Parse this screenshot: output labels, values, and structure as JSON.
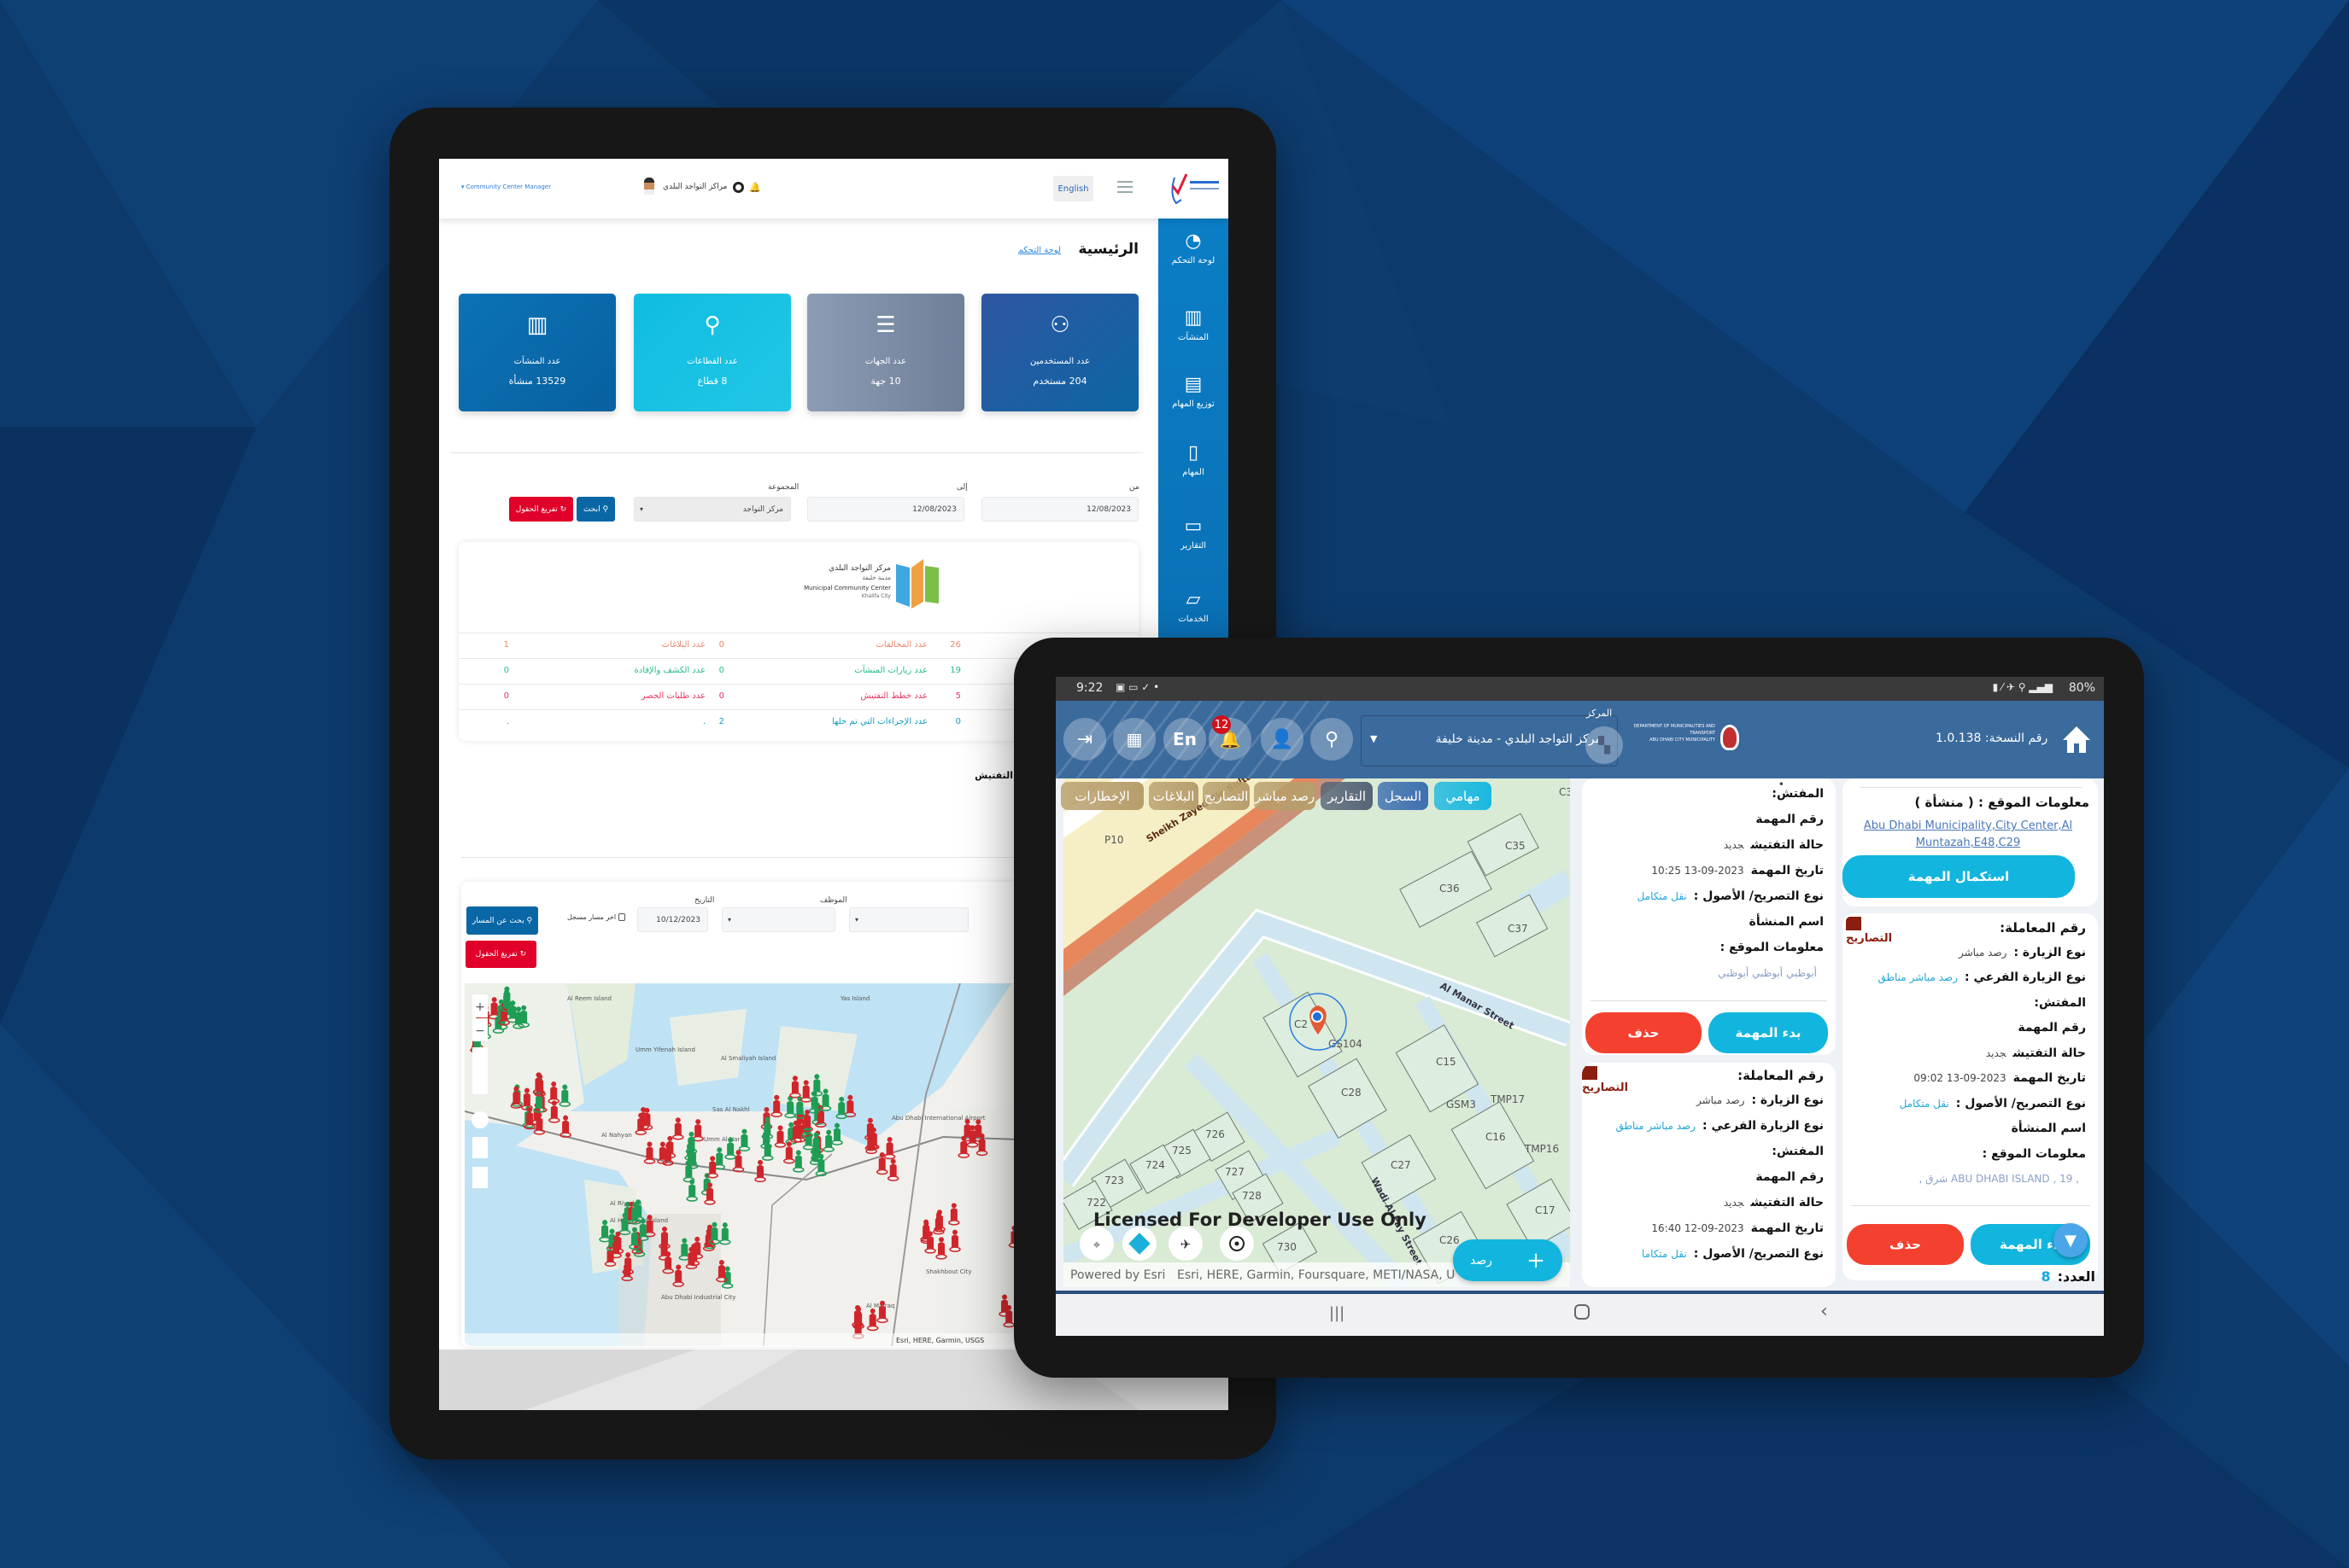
{
  "left_tablet": {
    "header": {
      "user_role": "Community Center Manager",
      "center_name": "مراكز التواجد البلدي",
      "language_button": "English"
    },
    "sidebar": [
      {
        "label": "لوحة التحكم",
        "icon": "speedometer-icon"
      },
      {
        "label": "المنشآت",
        "icon": "building-icon"
      },
      {
        "label": "توزيع المهام",
        "icon": "calendar-icon"
      },
      {
        "label": "المهام",
        "icon": "clipboard-icon"
      },
      {
        "label": "التقارير",
        "icon": "drive-icon"
      },
      {
        "label": "الخدمات",
        "icon": "folder-icon"
      }
    ],
    "page_title": "الرئيسية",
    "breadcrumb": "لوحة التحكم",
    "stat_cards": [
      {
        "label": "عدد المنشآت",
        "value": "13529 منشأة",
        "icon": "building-icon",
        "color": "#0a6aa8"
      },
      {
        "label": "عدد القطاعات",
        "value": "8 قطاع",
        "icon": "location-pin-icon",
        "color": "#17c1e3"
      },
      {
        "label": "عدد الجهات",
        "value": "10 جهة",
        "icon": "list-icon",
        "color": "#7b8aa3"
      },
      {
        "label": "عدد المستخدمين",
        "value": "204 مستخدم",
        "icon": "users-icon",
        "color": "#1f5aa2"
      }
    ],
    "filters": {
      "from_label": "من",
      "from_value": "12/08/2023",
      "to_label": "إلى",
      "to_value": "12/08/2023",
      "group_label": "المجموعة",
      "group_value": "مركز التواجد",
      "search_button": "ابحث",
      "clear_button": "تفريغ الحقول"
    },
    "center_logo": {
      "ar": "مركز التواجد البلدي",
      "ar_sub": "مدينة خليفة",
      "en": "Municipal Community Center",
      "en_sub": "Khalifa City"
    },
    "stats_rows": [
      {
        "cells": [
          "26",
          "عدد المخالفات",
          "0",
          "عدد البلاغات",
          "1"
        ],
        "color": "#f0876a"
      },
      {
        "cells": [
          "19",
          "عدد زيارات المنشآت",
          "0",
          "عدد الكشف والإفادة",
          "0"
        ],
        "color": "#23bf86"
      },
      {
        "cells": [
          "5",
          "عدد خطط التفتيش",
          "0",
          "عدد طلبات الحصر",
          "0"
        ],
        "color": "#e6365f"
      },
      {
        "cells": [
          "0",
          "عدد الإجراءات التي تم حلها",
          "2",
          ".",
          "."
        ],
        "color": "#139fc4"
      }
    ],
    "inspection": {
      "heading": "التفتيش",
      "employee_label": "الموظف",
      "date_label": "التاريخ",
      "date_value": "10/12/2023",
      "last_path_checkbox": "اخر مسار مسجل",
      "search_path_button": "بحث عن المسار",
      "clear_button": "تفريغ الحقول",
      "map_attribution": "Esri, HERE, Garmin, USGS",
      "map_labels": [
        "Al Reem Island",
        "Umm Yifenah Island",
        "Al Smaliyah Island",
        "Sas Al Nakhl",
        "Umm Al Nar",
        "Al Hidayriyat Island",
        "Yas Island",
        "Abu Dhabi International Airport",
        "Shakhbout City",
        "Al Mafraq",
        "Abu Dhabi Industrial City",
        "Al Nahyan",
        "Al Riyadah"
      ],
      "pin_colors": {
        "green": "#1f9d55",
        "red": "#d0262b"
      }
    }
  },
  "right_tablet": {
    "status_bar": {
      "time": "9:22",
      "battery": "80%"
    },
    "header": {
      "version": "رقم النسخة: 1.0.138",
      "center_label": "المركز",
      "center_value": "مركز التواجد البلدي - مدينة خليفة",
      "language_button": "En",
      "notification_count": "12",
      "org_name_en": "DEPARTMENT OF MUNICIPALITIES AND TRANSPORT",
      "org_sub_en": "ABU DHABI CITY MUNICIPALITY"
    },
    "tabs": [
      {
        "label": "مهامي",
        "color": "#1bb8e0"
      },
      {
        "label": "السجل",
        "color": "#3d6fb0"
      },
      {
        "label": "التقارير",
        "color": "#566477"
      },
      {
        "label": "رصد مباشر",
        "color": "#b79e6c"
      },
      {
        "label": "التصاريح",
        "color": "#b79e6c"
      },
      {
        "label": "البلاغات",
        "color": "#b79e6c"
      },
      {
        "label": "الإخطارات",
        "color": "#b79e6c"
      }
    ],
    "map": {
      "streets": [
        "Sheikh Zayed Bin Sultan",
        "Al Manar Street",
        "Wadi Al Fay Street"
      ],
      "parcels": [
        "P10",
        "C35",
        "C36",
        "C37",
        "C2",
        "GS104",
        "C15",
        "C28",
        "GSM3",
        "TMP17",
        "C16",
        "TMP16",
        "C27",
        "C17",
        "C26",
        "726",
        "725",
        "724",
        "723",
        "727",
        "728",
        "722",
        "730",
        "C3"
      ],
      "license_text": "Licensed For Developer Use Only",
      "powered_by": "Powered by Esri",
      "attribution": "Esri, HERE, Garmin, Foursquare, METI/NASA, U",
      "add_button": "رصد"
    },
    "middle_cards": [
      {
        "badge": "",
        "rows": [
          {
            "label": "المفتش:",
            "value": ""
          },
          {
            "label": "رقم المهمة",
            "value": ""
          },
          {
            "label": "حالة التفتيش",
            "value": "جديد"
          },
          {
            "label": "تاريخ المهمة",
            "value": "2023-09-13 10:25"
          },
          {
            "label": "نوع التصريح/ الأصول :",
            "value": "نقل متكامل",
            "accent": true
          },
          {
            "label": "اسم المنشأة",
            "value": ""
          },
          {
            "label": "معلومات الموقع :",
            "value": ""
          },
          {
            "label": "",
            "value": "أبوظبي أبوظبي أبوظبي",
            "light": true
          }
        ],
        "start_button": "بدء المهمة",
        "delete_button": "حذف"
      },
      {
        "badge": "التصاريح",
        "rows": [
          {
            "label": "رقم المعاملة:",
            "value": "",
            "title": true
          },
          {
            "label": "نوع الزيارة :",
            "value": "رصد مباشر"
          },
          {
            "label": "نوع الزيارة الفرعي :",
            "value": "رصد مباشر مناطق",
            "accent": true
          },
          {
            "label": "المفتش:",
            "value": ""
          },
          {
            "label": "رقم المهمة",
            "value": ""
          },
          {
            "label": "حالة التفتيش",
            "value": "جديد"
          },
          {
            "label": "تاريخ المهمة",
            "value": "2023-09-12 16:40"
          },
          {
            "label": "نوع التصريح/ الأصول :",
            "value": "نقل متكاما",
            "accent": true
          }
        ]
      }
    ],
    "right_cards": [
      {
        "location_title": "معلومات الموقع : ( منشأة )",
        "location_link": "Abu Dhabi Municipality,City Center,Al Muntazah,E48,C29",
        "complete_button": "استكمال المهمة"
      },
      {
        "badge": "التصاريح",
        "rows": [
          {
            "label": "رقم المعاملة:",
            "value": "",
            "title": true
          },
          {
            "label": "نوع الزيارة :",
            "value": "رصد مباشر"
          },
          {
            "label": "نوع الزيارة الفرعي :",
            "value": "رصد مباشر مناطق",
            "accent": true
          },
          {
            "label": "المفتش:",
            "value": ""
          },
          {
            "label": "رقم المهمة",
            "value": ""
          },
          {
            "label": "حالة التفتيش",
            "value": "جديد"
          },
          {
            "label": "تاريخ المهمة",
            "value": "2023-09-13 09:02"
          },
          {
            "label": "نوع التصريح/ الأصول :",
            "value": "نقل متكامل",
            "accent": true
          },
          {
            "label": "اسم المنشأة",
            "value": ""
          },
          {
            "label": "معلومات الموقع :",
            "value": ""
          },
          {
            "label": "",
            "value": ", ABU DHABI ISLAND , 19 شرق ,",
            "light": true
          }
        ],
        "start_button": "بدء المهمة",
        "delete_button": "حذف"
      }
    ],
    "count_label": "العدد:",
    "count_value": "8"
  }
}
